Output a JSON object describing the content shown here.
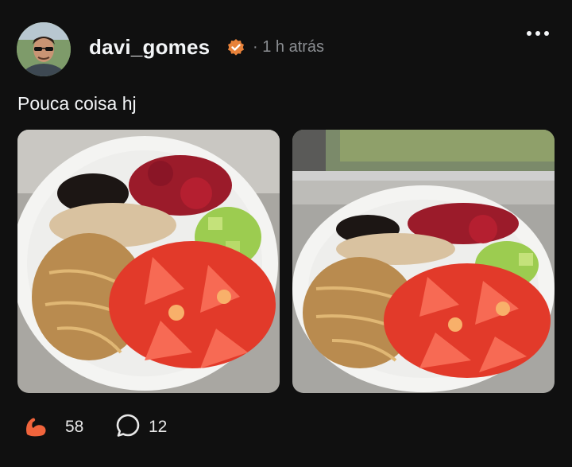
{
  "post": {
    "username": "davi_gomes",
    "time_separator": "·",
    "time": "1 h atrás",
    "caption": "Pouca coisa hj",
    "likes": "58",
    "comments": "12"
  },
  "icons": {
    "verified": "verified-badge-icon",
    "more": "more-dots-icon",
    "like": "flexed-bicep-icon",
    "comment": "speech-bubble-icon"
  },
  "colors": {
    "background": "#101010",
    "text": "#f3f5f7",
    "muted": "#8a8d91",
    "verified_badge": "#e8823a",
    "like_icon": "#f0643c"
  }
}
